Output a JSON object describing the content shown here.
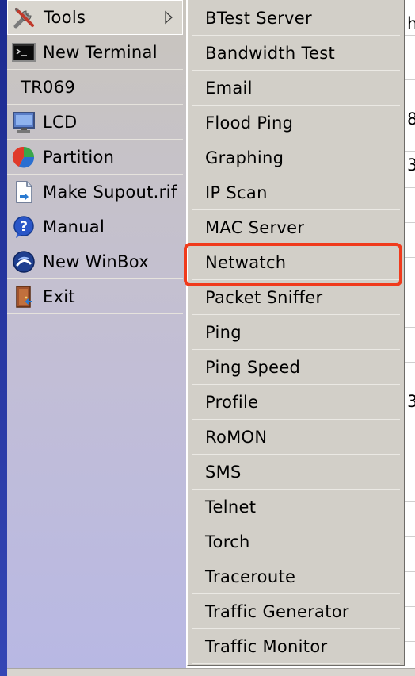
{
  "side_menu": {
    "items": [
      {
        "label": "Tools",
        "icon": "tools-icon"
      },
      {
        "label": "New Terminal",
        "icon": "terminal-icon"
      },
      {
        "label": "TR069"
      },
      {
        "label": "LCD",
        "icon": "monitor-icon"
      },
      {
        "label": "Partition",
        "icon": "pie-chart-icon"
      },
      {
        "label": "Make Supout.rif",
        "icon": "document-icon"
      },
      {
        "label": "Manual",
        "icon": "help-icon"
      },
      {
        "label": "New WinBox",
        "icon": "winbox-icon"
      },
      {
        "label": "Exit",
        "icon": "exit-door-icon"
      }
    ]
  },
  "tools_submenu": {
    "items": [
      "BTest Server",
      "Bandwidth Test",
      "Email",
      "Flood Ping",
      "Graphing",
      "IP Scan",
      "MAC Server",
      "Netwatch",
      "Packet Sniffer",
      "Ping",
      "Ping Speed",
      "Profile",
      "RoMON",
      "SMS",
      "Telnet",
      "Torch",
      "Traceroute",
      "Traffic Generator",
      "Traffic Monitor"
    ],
    "highlighted": "Netwatch"
  },
  "background_fragments": [
    "h",
    "8",
    "3",
    "3"
  ],
  "colors": {
    "highlight_border": "#f03a1c",
    "menu_bg": "#d2cfc8"
  }
}
